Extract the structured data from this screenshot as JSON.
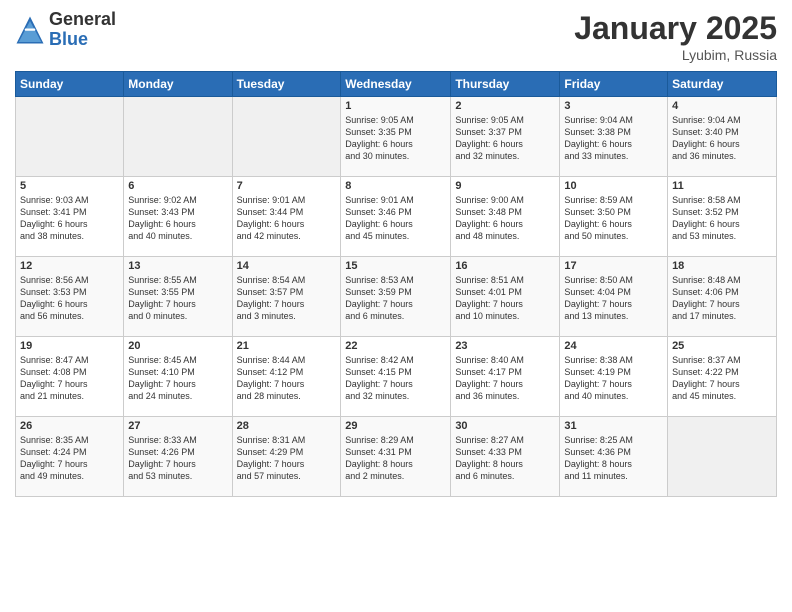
{
  "logo": {
    "general": "General",
    "blue": "Blue"
  },
  "title": {
    "month": "January 2025",
    "location": "Lyubim, Russia"
  },
  "headers": [
    "Sunday",
    "Monday",
    "Tuesday",
    "Wednesday",
    "Thursday",
    "Friday",
    "Saturday"
  ],
  "weeks": [
    [
      {
        "day": "",
        "info": ""
      },
      {
        "day": "",
        "info": ""
      },
      {
        "day": "",
        "info": ""
      },
      {
        "day": "1",
        "info": "Sunrise: 9:05 AM\nSunset: 3:35 PM\nDaylight: 6 hours\nand 30 minutes."
      },
      {
        "day": "2",
        "info": "Sunrise: 9:05 AM\nSunset: 3:37 PM\nDaylight: 6 hours\nand 32 minutes."
      },
      {
        "day": "3",
        "info": "Sunrise: 9:04 AM\nSunset: 3:38 PM\nDaylight: 6 hours\nand 33 minutes."
      },
      {
        "day": "4",
        "info": "Sunrise: 9:04 AM\nSunset: 3:40 PM\nDaylight: 6 hours\nand 36 minutes."
      }
    ],
    [
      {
        "day": "5",
        "info": "Sunrise: 9:03 AM\nSunset: 3:41 PM\nDaylight: 6 hours\nand 38 minutes."
      },
      {
        "day": "6",
        "info": "Sunrise: 9:02 AM\nSunset: 3:43 PM\nDaylight: 6 hours\nand 40 minutes."
      },
      {
        "day": "7",
        "info": "Sunrise: 9:01 AM\nSunset: 3:44 PM\nDaylight: 6 hours\nand 42 minutes."
      },
      {
        "day": "8",
        "info": "Sunrise: 9:01 AM\nSunset: 3:46 PM\nDaylight: 6 hours\nand 45 minutes."
      },
      {
        "day": "9",
        "info": "Sunrise: 9:00 AM\nSunset: 3:48 PM\nDaylight: 6 hours\nand 48 minutes."
      },
      {
        "day": "10",
        "info": "Sunrise: 8:59 AM\nSunset: 3:50 PM\nDaylight: 6 hours\nand 50 minutes."
      },
      {
        "day": "11",
        "info": "Sunrise: 8:58 AM\nSunset: 3:52 PM\nDaylight: 6 hours\nand 53 minutes."
      }
    ],
    [
      {
        "day": "12",
        "info": "Sunrise: 8:56 AM\nSunset: 3:53 PM\nDaylight: 6 hours\nand 56 minutes."
      },
      {
        "day": "13",
        "info": "Sunrise: 8:55 AM\nSunset: 3:55 PM\nDaylight: 7 hours\nand 0 minutes."
      },
      {
        "day": "14",
        "info": "Sunrise: 8:54 AM\nSunset: 3:57 PM\nDaylight: 7 hours\nand 3 minutes."
      },
      {
        "day": "15",
        "info": "Sunrise: 8:53 AM\nSunset: 3:59 PM\nDaylight: 7 hours\nand 6 minutes."
      },
      {
        "day": "16",
        "info": "Sunrise: 8:51 AM\nSunset: 4:01 PM\nDaylight: 7 hours\nand 10 minutes."
      },
      {
        "day": "17",
        "info": "Sunrise: 8:50 AM\nSunset: 4:04 PM\nDaylight: 7 hours\nand 13 minutes."
      },
      {
        "day": "18",
        "info": "Sunrise: 8:48 AM\nSunset: 4:06 PM\nDaylight: 7 hours\nand 17 minutes."
      }
    ],
    [
      {
        "day": "19",
        "info": "Sunrise: 8:47 AM\nSunset: 4:08 PM\nDaylight: 7 hours\nand 21 minutes."
      },
      {
        "day": "20",
        "info": "Sunrise: 8:45 AM\nSunset: 4:10 PM\nDaylight: 7 hours\nand 24 minutes."
      },
      {
        "day": "21",
        "info": "Sunrise: 8:44 AM\nSunset: 4:12 PM\nDaylight: 7 hours\nand 28 minutes."
      },
      {
        "day": "22",
        "info": "Sunrise: 8:42 AM\nSunset: 4:15 PM\nDaylight: 7 hours\nand 32 minutes."
      },
      {
        "day": "23",
        "info": "Sunrise: 8:40 AM\nSunset: 4:17 PM\nDaylight: 7 hours\nand 36 minutes."
      },
      {
        "day": "24",
        "info": "Sunrise: 8:38 AM\nSunset: 4:19 PM\nDaylight: 7 hours\nand 40 minutes."
      },
      {
        "day": "25",
        "info": "Sunrise: 8:37 AM\nSunset: 4:22 PM\nDaylight: 7 hours\nand 45 minutes."
      }
    ],
    [
      {
        "day": "26",
        "info": "Sunrise: 8:35 AM\nSunset: 4:24 PM\nDaylight: 7 hours\nand 49 minutes."
      },
      {
        "day": "27",
        "info": "Sunrise: 8:33 AM\nSunset: 4:26 PM\nDaylight: 7 hours\nand 53 minutes."
      },
      {
        "day": "28",
        "info": "Sunrise: 8:31 AM\nSunset: 4:29 PM\nDaylight: 7 hours\nand 57 minutes."
      },
      {
        "day": "29",
        "info": "Sunrise: 8:29 AM\nSunset: 4:31 PM\nDaylight: 8 hours\nand 2 minutes."
      },
      {
        "day": "30",
        "info": "Sunrise: 8:27 AM\nSunset: 4:33 PM\nDaylight: 8 hours\nand 6 minutes."
      },
      {
        "day": "31",
        "info": "Sunrise: 8:25 AM\nSunset: 4:36 PM\nDaylight: 8 hours\nand 11 minutes."
      },
      {
        "day": "",
        "info": ""
      }
    ]
  ]
}
